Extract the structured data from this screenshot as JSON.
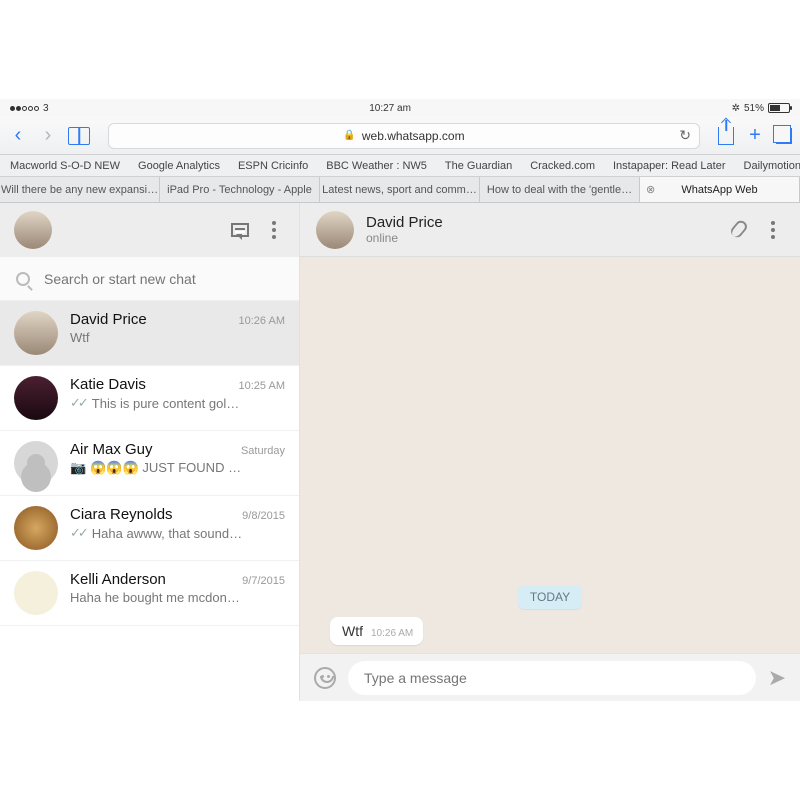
{
  "statusbar": {
    "carrier": "3",
    "time": "10:27 am",
    "battery_pct": "51%"
  },
  "safari": {
    "url_host": "web.whatsapp.com",
    "bookmarks": [
      "Macworld S-O-D NEW",
      "Google Analytics",
      "ESPN Cricinfo",
      "BBC Weather : NW5",
      "The Guardian",
      "Cracked.com",
      "Instapaper: Read Later",
      "Dailymotion"
    ],
    "tabs": [
      "Will there be any new expansi…",
      "iPad Pro - Technology - Apple",
      "Latest news, sport and comm…",
      "How to deal with the 'gentle…",
      "WhatsApp Web"
    ]
  },
  "sidebar": {
    "search_placeholder": "Search or start new chat",
    "chats": [
      {
        "name": "David Price",
        "time": "10:26 AM",
        "preview": "Wtf",
        "ticks": false,
        "icon": "",
        "av": "av1",
        "active": true
      },
      {
        "name": "Katie Davis",
        "time": "10:25 AM",
        "preview": "This is pure content gol…",
        "ticks": true,
        "icon": "",
        "av": "av2"
      },
      {
        "name": "Air Max Guy",
        "time": "Saturday",
        "preview": "😱😱😱 JUST FOUND …",
        "ticks": false,
        "icon": "📷",
        "av": "av3"
      },
      {
        "name": "Ciara Reynolds",
        "time": "9/8/2015",
        "preview": "Haha awww, that sound…",
        "ticks": true,
        "icon": "",
        "av": "av4"
      },
      {
        "name": "Kelli Anderson",
        "time": "9/7/2015",
        "preview": "Haha he bought me mcdon…",
        "ticks": false,
        "icon": "",
        "av": "av5"
      }
    ]
  },
  "chat": {
    "name": "David Price",
    "status": "online",
    "day_label": "TODAY",
    "messages": [
      {
        "text": "Wtf",
        "time": "10:26 AM"
      }
    ],
    "composer_placeholder": "Type a message"
  }
}
